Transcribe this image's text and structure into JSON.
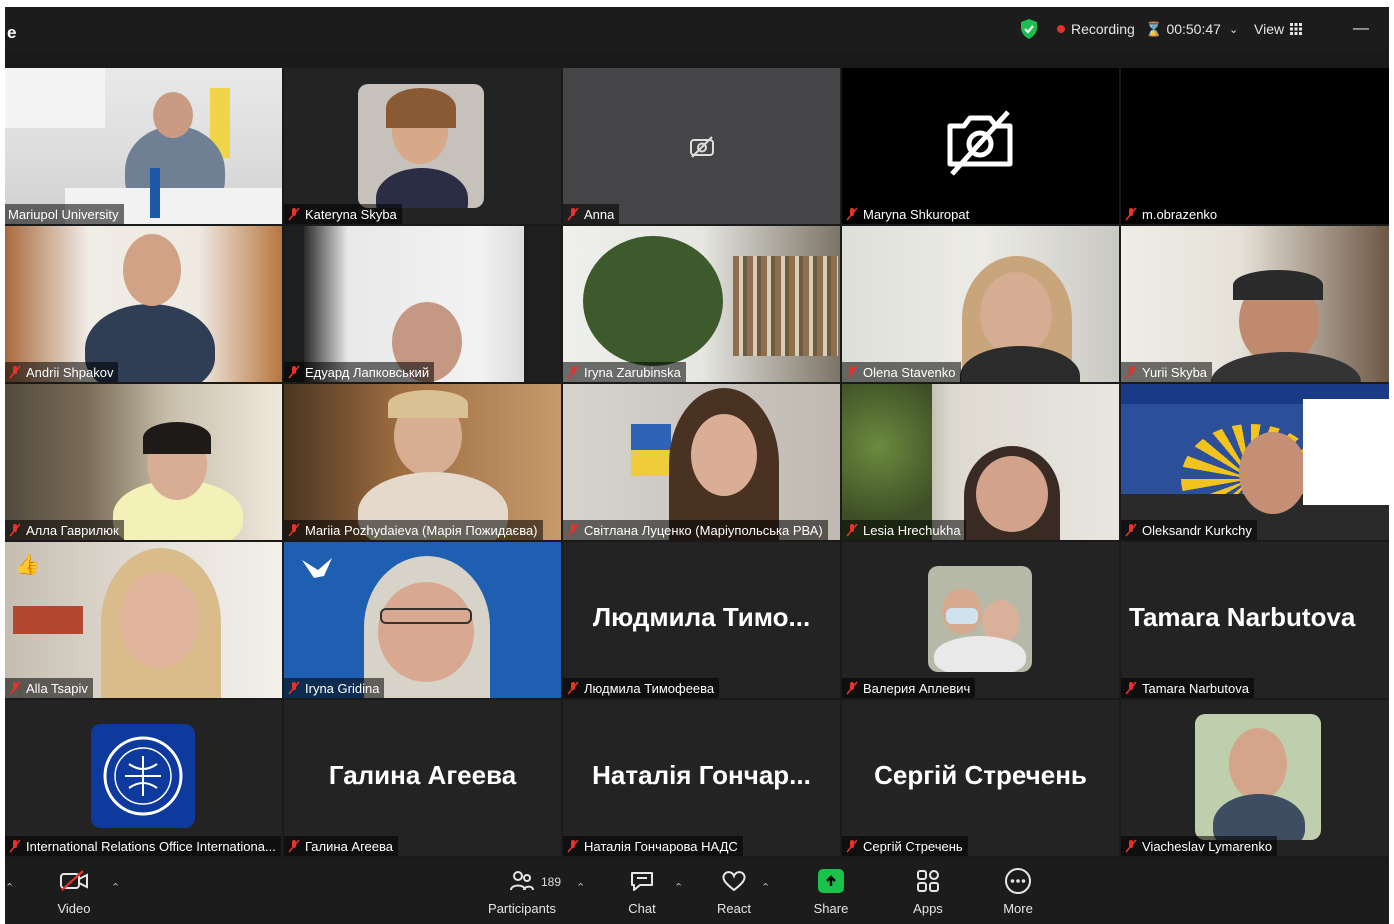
{
  "window": {
    "title": "e"
  },
  "topbar": {
    "recording_label": "Recording",
    "timer": "00:50:47",
    "view_label": "View",
    "minimize_symbol": "—"
  },
  "colors": {
    "active_speaker": "#2dd56b",
    "recording": "#e5322d",
    "muted": "#e5322d",
    "share": "#19c34b"
  },
  "tiles": [
    {
      "name": "Mariupol University",
      "kind": "video",
      "muted": false,
      "active": true
    },
    {
      "name": "Kateryna Skyba",
      "kind": "photo",
      "muted": true
    },
    {
      "name": "Anna",
      "kind": "video-off-small",
      "muted": true
    },
    {
      "name": "Maryna Shkuropat",
      "kind": "video-off-large",
      "muted": true
    },
    {
      "name": "m.obrazenko",
      "kind": "blank",
      "muted": true
    },
    {
      "name": "Andrii Shpakov",
      "kind": "video",
      "muted": true
    },
    {
      "name": "Едуард Лапковський",
      "kind": "video",
      "muted": true
    },
    {
      "name": "Iryna Zarubinska",
      "kind": "video",
      "muted": true
    },
    {
      "name": "Olena Stavenko",
      "kind": "video",
      "muted": true
    },
    {
      "name": "Yurii Skyba",
      "kind": "video",
      "muted": true
    },
    {
      "name": "Алла Гаврилюк",
      "kind": "video",
      "muted": true
    },
    {
      "name": "Mariia Pozhydaieva (Марія Пожидаєва)",
      "kind": "video",
      "muted": true
    },
    {
      "name": "Світлана Луценко (Маріупольська РВА)",
      "kind": "video",
      "muted": true
    },
    {
      "name": "Lesia Hrechukha",
      "kind": "video",
      "muted": true
    },
    {
      "name": "Oleksandr Kurkchy",
      "kind": "video",
      "muted": true
    },
    {
      "name": "Alla Tsapiv",
      "kind": "video",
      "muted": true,
      "reaction": "👍"
    },
    {
      "name": "Iryna Gridina",
      "kind": "video",
      "muted": true
    },
    {
      "name": "Людмила Тимофеева",
      "kind": "text",
      "big": "Людмила  Тимо...",
      "muted": true
    },
    {
      "name": "Валерия Аплевич",
      "kind": "photo",
      "muted": true
    },
    {
      "name": "Tamara Narbutova",
      "kind": "text",
      "big": "Tamara Narbutova",
      "muted": true
    },
    {
      "name": "International Relations Office Internationa...",
      "kind": "logo",
      "muted": true
    },
    {
      "name": "Галина Агеева",
      "kind": "text",
      "big": "Галина Агеева",
      "muted": true
    },
    {
      "name": "Наталія Гончарова НАДС",
      "kind": "text",
      "big": "Наталія  Гончар...",
      "muted": true
    },
    {
      "name": "Сергій Стречень",
      "kind": "text",
      "big": "Сергій Стречень",
      "muted": true
    },
    {
      "name": "Viacheslav Lymarenko",
      "kind": "photo",
      "muted": true
    }
  ],
  "toolbar": {
    "video_label": "Video",
    "participants_label": "Participants",
    "participants_count": "189",
    "chat_label": "Chat",
    "react_label": "React",
    "share_label": "Share",
    "apps_label": "Apps",
    "more_label": "More"
  },
  "icons": [
    "shield-check-icon",
    "recording-dot-icon",
    "hourglass-icon",
    "grid-view-icon",
    "mic-muted-icon",
    "video-off-icon",
    "participants-icon",
    "chat-icon",
    "react-heart-icon",
    "share-arrow-icon",
    "apps-icon",
    "more-icon"
  ]
}
